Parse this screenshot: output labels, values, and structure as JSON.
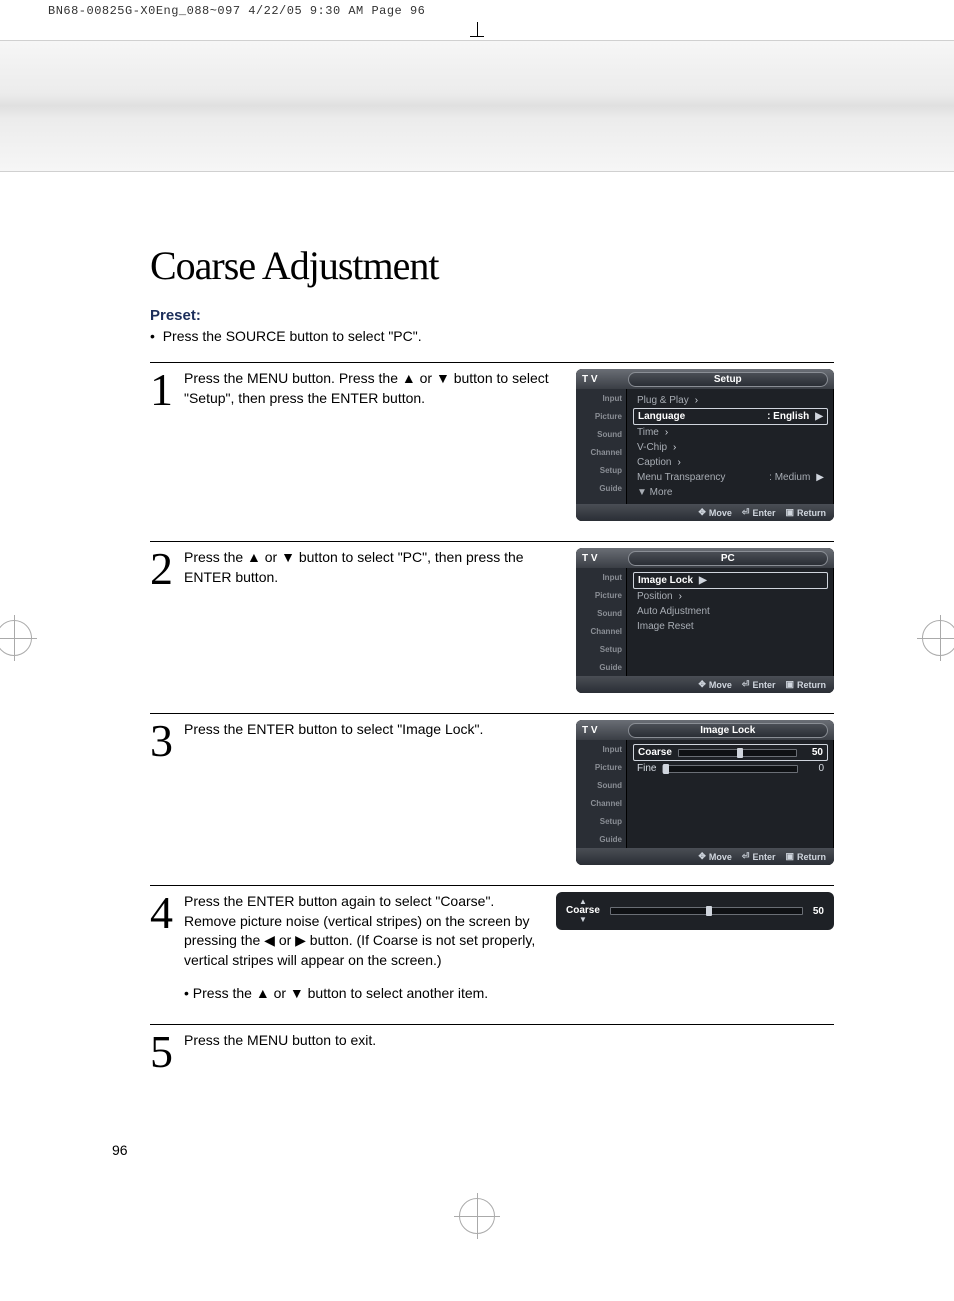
{
  "print_header": "BN68-00825G-X0Eng_088~097  4/22/05  9:30 AM  Page 96",
  "title": "Coarse Adjustment",
  "preset_label": "Preset:",
  "preset_item": "Press the SOURCE button to select \"PC\".",
  "steps": {
    "s1": {
      "num": "1",
      "text": "Press the MENU button. Press the ▲ or ▼ button to select \"Setup\", then press the ENTER button."
    },
    "s2": {
      "num": "2",
      "text": "Press the ▲ or ▼ button to select \"PC\", then press the ENTER button."
    },
    "s3": {
      "num": "3",
      "text": "Press the ENTER button to select \"Image Lock\"."
    },
    "s4": {
      "num": "4",
      "text": "Press the ENTER button again to select \"Coarse\". Remove picture noise (vertical stripes) on the screen by pressing the ◀ or ▶ button. (If Coarse is not set properly, vertical stripes will appear on the screen.)",
      "sub": "•  Press the ▲ or ▼ button to select another item."
    },
    "s5": {
      "num": "5",
      "text": "Press the MENU button to exit."
    }
  },
  "osd": {
    "tv_label": "T V",
    "side": [
      "Input",
      "Picture",
      "Sound",
      "Channel",
      "Setup",
      "Guide"
    ],
    "foot": {
      "move": "Move",
      "enter": "Enter",
      "ret": "Return"
    },
    "setup": {
      "title": "Setup",
      "rows": [
        {
          "label": "Plug & Play",
          "arr": "√"
        },
        {
          "label": "Language",
          "val": ": English",
          "sel": true,
          "arr": "▶"
        },
        {
          "label": "Time",
          "arr": "√"
        },
        {
          "label": "V-Chip",
          "arr": "√"
        },
        {
          "label": "Caption",
          "arr": "√"
        },
        {
          "label": "Menu Transparency",
          "val": ": Medium",
          "arr": "▶"
        },
        {
          "label": "▼ More"
        }
      ]
    },
    "pc": {
      "title": "PC",
      "rows": [
        {
          "label": "Image Lock",
          "sel": true,
          "arr": "▶"
        },
        {
          "label": "Position",
          "arr": "▶"
        },
        {
          "label": "Auto Adjustment"
        },
        {
          "label": "Image Reset"
        }
      ]
    },
    "imagelock": {
      "title": "Image Lock",
      "coarse": {
        "label": "Coarse",
        "value": 50,
        "pct": 50
      },
      "fine": {
        "label": "Fine",
        "value": 0,
        "pct": 0
      }
    },
    "bar": {
      "label": "Coarse",
      "value": 50,
      "pct": 50
    }
  },
  "page_number": "96"
}
